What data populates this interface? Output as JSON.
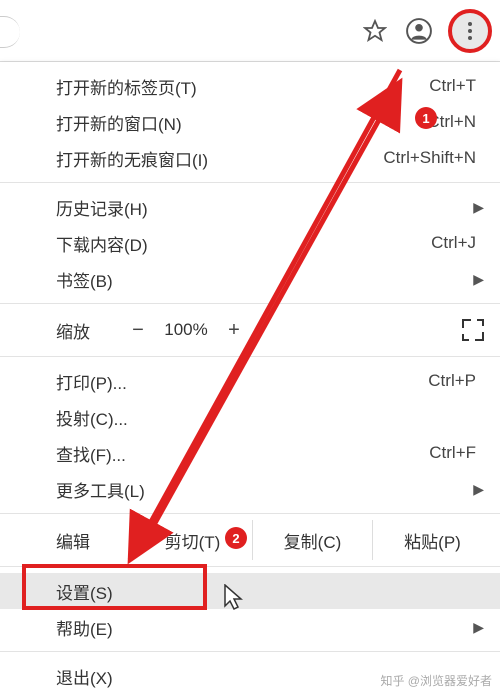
{
  "toolbar": {
    "star": "☆",
    "profile": "person"
  },
  "menu": {
    "new_tab": {
      "label": "打开新的标签页(T)",
      "shortcut": "Ctrl+T"
    },
    "new_window": {
      "label": "打开新的窗口(N)",
      "shortcut": "Ctrl+N"
    },
    "new_incognito": {
      "label": "打开新的无痕窗口(I)",
      "shortcut": "Ctrl+Shift+N"
    },
    "history": {
      "label": "历史记录(H)"
    },
    "downloads": {
      "label": "下载内容(D)",
      "shortcut": "Ctrl+J"
    },
    "bookmarks": {
      "label": "书签(B)"
    },
    "zoom": {
      "label": "缩放",
      "minus": "−",
      "value": "100%",
      "plus": "+"
    },
    "print": {
      "label": "打印(P)...",
      "shortcut": "Ctrl+P"
    },
    "cast": {
      "label": "投射(C)..."
    },
    "find": {
      "label": "查找(F)...",
      "shortcut": "Ctrl+F"
    },
    "more_tools": {
      "label": "更多工具(L)"
    },
    "edit": {
      "label": "编辑",
      "cut": "剪切(T)",
      "copy": "复制(C)",
      "paste": "粘贴(P)"
    },
    "settings": {
      "label": "设置(S)"
    },
    "help": {
      "label": "帮助(E)"
    },
    "exit": {
      "label": "退出(X)"
    }
  },
  "annotations": {
    "badge1": "1",
    "badge2": "2"
  },
  "watermark": "知乎 @浏览器爱好者"
}
